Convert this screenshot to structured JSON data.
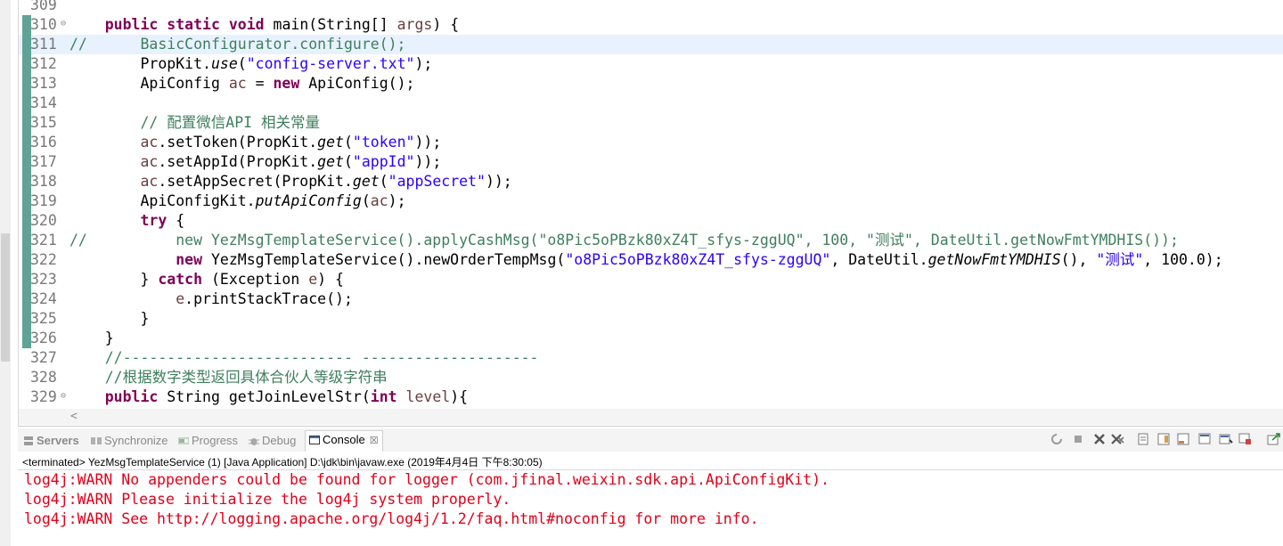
{
  "editor": {
    "lines": [
      {
        "n": "309",
        "fold": "",
        "hl": false,
        "mark": false,
        "segs": []
      },
      {
        "n": "310",
        "fold": "⊖",
        "hl": false,
        "mark": true,
        "segs": [
          [
            "    ",
            ""
          ],
          [
            "public",
            "kw"
          ],
          [
            " ",
            ""
          ],
          [
            "static",
            "kw"
          ],
          [
            " ",
            ""
          ],
          [
            "void",
            "kw"
          ],
          [
            " main(String[] ",
            ""
          ],
          [
            "args",
            "var"
          ],
          [
            ") {",
            ""
          ]
        ]
      },
      {
        "n": "311",
        "fold": "",
        "hl": true,
        "mark": true,
        "segs": [
          [
            "//      BasicConfigurator.configure();",
            "cm"
          ]
        ]
      },
      {
        "n": "312",
        "fold": "",
        "hl": false,
        "mark": true,
        "segs": [
          [
            "        PropKit.",
            ""
          ],
          [
            "use",
            "it"
          ],
          [
            "(",
            ""
          ],
          [
            "\"config-server.txt\"",
            "str"
          ],
          [
            ");",
            ""
          ]
        ]
      },
      {
        "n": "313",
        "fold": "",
        "hl": false,
        "mark": true,
        "segs": [
          [
            "        ApiConfig ",
            ""
          ],
          [
            "ac",
            "var"
          ],
          [
            " = ",
            ""
          ],
          [
            "new",
            "kw"
          ],
          [
            " ApiConfig();",
            ""
          ]
        ]
      },
      {
        "n": "314",
        "fold": "",
        "hl": false,
        "mark": true,
        "segs": []
      },
      {
        "n": "315",
        "fold": "",
        "hl": false,
        "mark": true,
        "segs": [
          [
            "        // 配置微信API 相关常量",
            "cm"
          ]
        ]
      },
      {
        "n": "316",
        "fold": "",
        "hl": false,
        "mark": true,
        "segs": [
          [
            "        ",
            ""
          ],
          [
            "ac",
            "var"
          ],
          [
            ".setToken(PropKit.",
            ""
          ],
          [
            "get",
            "it"
          ],
          [
            "(",
            ""
          ],
          [
            "\"token\"",
            "str"
          ],
          [
            "));",
            ""
          ]
        ]
      },
      {
        "n": "317",
        "fold": "",
        "hl": false,
        "mark": true,
        "segs": [
          [
            "        ",
            ""
          ],
          [
            "ac",
            "var"
          ],
          [
            ".setAppId(PropKit.",
            ""
          ],
          [
            "get",
            "it"
          ],
          [
            "(",
            ""
          ],
          [
            "\"appId\"",
            "str"
          ],
          [
            "));",
            ""
          ]
        ]
      },
      {
        "n": "318",
        "fold": "",
        "hl": false,
        "mark": true,
        "segs": [
          [
            "        ",
            ""
          ],
          [
            "ac",
            "var"
          ],
          [
            ".setAppSecret(PropKit.",
            ""
          ],
          [
            "get",
            "it"
          ],
          [
            "(",
            ""
          ],
          [
            "\"appSecret\"",
            "str"
          ],
          [
            "));",
            ""
          ]
        ]
      },
      {
        "n": "319",
        "fold": "",
        "hl": false,
        "mark": true,
        "segs": [
          [
            "        ApiConfigKit.",
            ""
          ],
          [
            "putApiConfig",
            "it"
          ],
          [
            "(",
            ""
          ],
          [
            "ac",
            "var"
          ],
          [
            ");",
            ""
          ]
        ]
      },
      {
        "n": "320",
        "fold": "",
        "hl": false,
        "mark": true,
        "segs": [
          [
            "        ",
            ""
          ],
          [
            "try",
            "kw"
          ],
          [
            " {",
            ""
          ]
        ]
      },
      {
        "n": "321",
        "fold": "",
        "hl": false,
        "mark": true,
        "segs": [
          [
            "//          new YezMsgTemplateService().applyCashMsg(\"o8Pic5oPBzk80xZ4T_sfys-zggUQ\", 100, \"测试\", DateUtil.getNowFmtYMDHIS());",
            "cm"
          ]
        ]
      },
      {
        "n": "322",
        "fold": "",
        "hl": false,
        "mark": true,
        "segs": [
          [
            "            ",
            ""
          ],
          [
            "new",
            "kw"
          ],
          [
            " YezMsgTemplateService().newOrderTempMsg(",
            ""
          ],
          [
            "\"o8Pic5oPBzk80xZ4T_sfys-zggUQ\"",
            "str"
          ],
          [
            ", DateUtil.",
            ""
          ],
          [
            "getNowFmtYMDHIS",
            "it"
          ],
          [
            "(), ",
            ""
          ],
          [
            "\"测试\"",
            "str"
          ],
          [
            ", 100.0);",
            ""
          ]
        ]
      },
      {
        "n": "323",
        "fold": "",
        "hl": false,
        "mark": true,
        "segs": [
          [
            "        } ",
            ""
          ],
          [
            "catch",
            "kw"
          ],
          [
            " (Exception ",
            ""
          ],
          [
            "e",
            "var"
          ],
          [
            ") {",
            ""
          ]
        ]
      },
      {
        "n": "324",
        "fold": "",
        "hl": false,
        "mark": true,
        "segs": [
          [
            "            ",
            ""
          ],
          [
            "e",
            "var"
          ],
          [
            ".printStackTrace();",
            ""
          ]
        ]
      },
      {
        "n": "325",
        "fold": "",
        "hl": false,
        "mark": true,
        "segs": [
          [
            "        }",
            ""
          ]
        ]
      },
      {
        "n": "326",
        "fold": "",
        "hl": false,
        "mark": true,
        "segs": [
          [
            "    }",
            ""
          ]
        ]
      },
      {
        "n": "327",
        "fold": "",
        "hl": false,
        "mark": false,
        "segs": [
          [
            "    //-------------------------- --------------------",
            "cm"
          ]
        ]
      },
      {
        "n": "328",
        "fold": "",
        "hl": false,
        "mark": false,
        "segs": [
          [
            "    //根据数字类型返回具体合伙人等级字符串",
            "cm"
          ]
        ]
      },
      {
        "n": "329",
        "fold": "⊖",
        "hl": false,
        "mark": false,
        "segs": [
          [
            "    ",
            ""
          ],
          [
            "public",
            "kw"
          ],
          [
            " String getJoinLevelStr(",
            ""
          ],
          [
            "int",
            "kw"
          ],
          [
            " ",
            ""
          ],
          [
            "level",
            "var"
          ],
          [
            "){",
            ""
          ]
        ]
      }
    ]
  },
  "scroll": {
    "left_arrow": "<"
  },
  "tabs": [
    {
      "id": "servers",
      "label": "Servers"
    },
    {
      "id": "synchronize",
      "label": "Synchronize"
    },
    {
      "id": "progress",
      "label": "Progress"
    },
    {
      "id": "debug",
      "label": "Debug"
    },
    {
      "id": "console",
      "label": "Console",
      "close": "☒"
    }
  ],
  "console": {
    "description": "<terminated> YezMsgTemplateService (1) [Java Application] D:\\jdk\\bin\\javaw.exe (2019年4月4日 下午8:30:05)",
    "lines": [
      "log4j:WARN No appenders could be found for logger (com.jfinal.weixin.sdk.api.ApiConfigKit).",
      "log4j:WARN Please initialize the log4j system properly.",
      "log4j:WARN See http://logging.apache.org/log4j/1.2/faq.html#noconfig for more info."
    ]
  },
  "colors": {
    "keyword": "#7f0055",
    "string": "#2a00ff",
    "comment": "#3f7f5f",
    "error": "#e0001a",
    "change_marker": "#5fa397"
  }
}
